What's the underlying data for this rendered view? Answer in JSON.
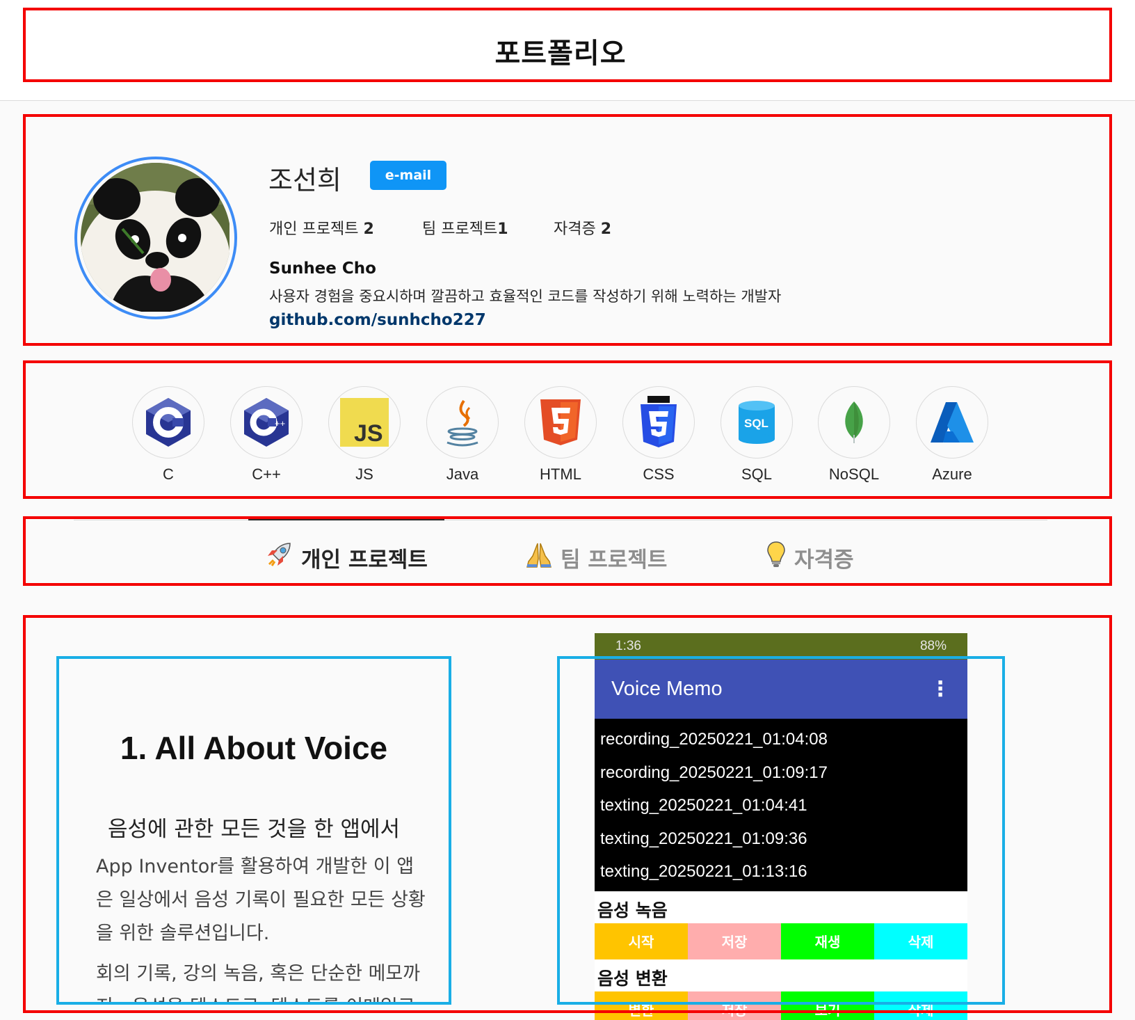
{
  "header": {
    "title": "포트폴리오"
  },
  "profile": {
    "name": "조선희",
    "email_label": "e-mail",
    "stats": [
      {
        "label": "개인 프로젝트 ",
        "value": "2"
      },
      {
        "label": "팀 프로젝트",
        "value": "1"
      },
      {
        "label": "자격증 ",
        "value": "2"
      }
    ],
    "full_name": "Sunhee Cho",
    "bio": "사용자 경험을 중요시하며 깔끔하고 효율적인 코드를 작성하기 위해 노력하는 개발자",
    "github": "github.com/sunhcho227"
  },
  "skills": [
    {
      "label": "C",
      "icon": "c-language-icon"
    },
    {
      "label": "C++",
      "icon": "cpp-language-icon"
    },
    {
      "label": "JS",
      "icon": "javascript-icon"
    },
    {
      "label": "Java",
      "icon": "java-icon"
    },
    {
      "label": "HTML",
      "icon": "html5-icon"
    },
    {
      "label": "CSS",
      "icon": "css3-icon"
    },
    {
      "label": "SQL",
      "icon": "sql-database-icon"
    },
    {
      "label": "NoSQL",
      "icon": "mongodb-leaf-icon"
    },
    {
      "label": "Azure",
      "icon": "azure-icon"
    }
  ],
  "tabs": [
    {
      "label": "개인 프로젝트",
      "icon": "rocket-icon",
      "active": true
    },
    {
      "label": "팀 프로젝트",
      "icon": "folded-hands-icon",
      "active": false
    },
    {
      "label": "자격증",
      "icon": "light-bulb-icon",
      "active": false
    }
  ],
  "project": {
    "title": "1. All About Voice",
    "subtitle": "음성에 관한 모든 것을 한 앱에서",
    "desc1": "App Inventor를 활용하여 개발한 이 앱은 일상에서 음성 기록이 필요한 모든 상황을 위한 솔루션입니다.",
    "desc2": "회의 기록, 강의 녹음, 혹은 단순한 메모까지 - 음성을 텍스트로, 텍스트를 이메일로"
  },
  "phone": {
    "status_time": "1:36",
    "status_right": "88%",
    "app_title": "Voice Memo",
    "memos": [
      "recording_20250221_01:04:08",
      "recording_20250221_01:09:17",
      "texting_20250221_01:04:41",
      "texting_20250221_01:09:36",
      "texting_20250221_01:13:16"
    ],
    "section1": "음성 녹음",
    "section1_buttons": [
      "시작",
      "저장",
      "재생",
      "삭제"
    ],
    "section2": "음성 변환",
    "section2_buttons": [
      "변환",
      "저장",
      "보기",
      "삭제"
    ],
    "button_colors": [
      "#ffc400",
      "#ffadad",
      "#00ff00",
      "#00ffff"
    ]
  },
  "colors": {
    "annotation_red": "#f40000",
    "annotation_blue": "#19aee6",
    "email_button": "#0f95f6",
    "link": "#00376b",
    "app_bar": "#3f51b5"
  }
}
